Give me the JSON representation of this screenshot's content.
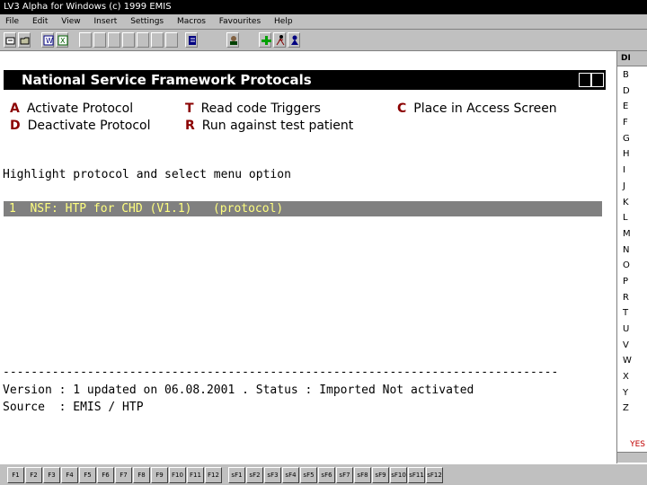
{
  "window": {
    "title": "LV3 Alpha for Windows (c) 1999 EMIS"
  },
  "menu": [
    "File",
    "Edit",
    "View",
    "Insert",
    "Settings",
    "Macros",
    "Favourites",
    "Help"
  ],
  "toolbar_icons": [
    "edit-icon",
    "folder-icon",
    "word-icon",
    "excel-icon",
    "blank-icon",
    "blank-icon",
    "blank-icon",
    "blank-icon",
    "blank-icon",
    "blank-icon",
    "blank-icon",
    "notes-icon",
    "person-icon",
    "plus-icon",
    "runner-icon",
    "user-icon"
  ],
  "panel": {
    "title": "National Service Framework Protocals",
    "options": [
      {
        "key": "A",
        "label": "Activate Protocol"
      },
      {
        "key": "D",
        "label": "Deactivate Protocol"
      },
      {
        "key": "T",
        "label": "Read code Triggers"
      },
      {
        "key": "R",
        "label": "Run against test patient"
      },
      {
        "key": "C",
        "label": "Place in Access Screen"
      }
    ],
    "instruction": "Highlight protocol and select menu option",
    "protocols": [
      "1  NSF: HTP for CHD (V1.1)   (protocol)"
    ],
    "separator": "-------------------------------------------------------------------------------",
    "version_line": "Version : 1 updated on 06.08.2001 . Status : Imported Not activated",
    "source_line": "Source  : EMIS / HTP"
  },
  "sidebar": {
    "header": "DI",
    "letters": [
      "B",
      "D",
      "E",
      "F",
      "G",
      "H",
      "I",
      "J",
      "K",
      "L",
      "M",
      "N",
      "O",
      "P",
      "R",
      "T",
      "U",
      "V",
      "W",
      "X",
      "Y",
      "Z"
    ],
    "yes_label": "YES"
  },
  "function_keys": [
    "F1",
    "F2",
    "F3",
    "F4",
    "F5",
    "F6",
    "F7",
    "F8",
    "F9",
    "F10",
    "F11",
    "F12",
    "sF1",
    "sF2",
    "sF3",
    "sF4",
    "sF5",
    "sF6",
    "sF7",
    "sF8",
    "sF9",
    "sF10",
    "sF11",
    "sF12"
  ],
  "colors": {
    "option_key": "#8b0000",
    "highlight_bg": "#808080",
    "highlight_text": "#ffff80",
    "chrome": "#c0c0c0"
  }
}
